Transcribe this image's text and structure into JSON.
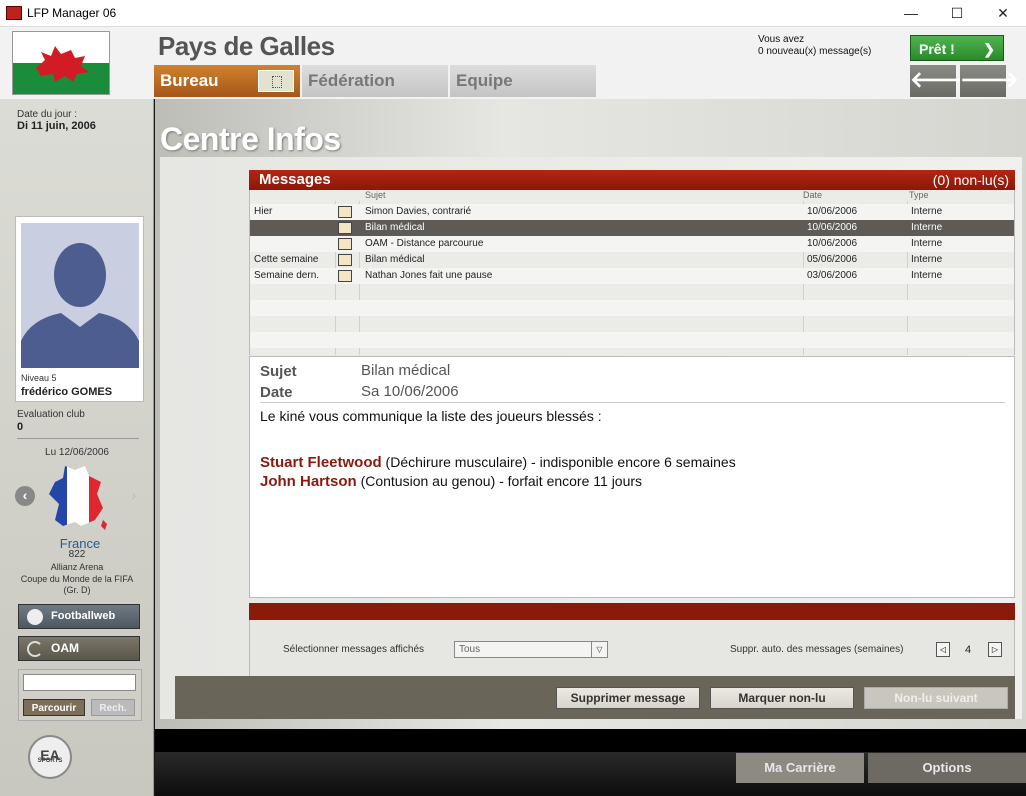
{
  "window": {
    "title": "LFP Manager 06",
    "min_glyph": "—",
    "max_glyph": "☐",
    "close_glyph": "✕"
  },
  "header": {
    "country": "Pays de Galles",
    "tabs": [
      {
        "label": "Bureau",
        "active": true
      },
      {
        "label": "Fédération",
        "active": false
      },
      {
        "label": "Equipe",
        "active": false
      }
    ],
    "notice_line1": "Vous avez",
    "notice_line2": "0 nouveau(x) message(s)",
    "ready_label": "Prêt !",
    "ready_arrow": "❯",
    "back_arrow": "🡐",
    "fwd_arrow": "🡒",
    "colors": {
      "active_tab": "#c2701f",
      "ready": "#3a9e3a"
    }
  },
  "sidebar": {
    "date_label": "Date du jour :",
    "date_value": "Di 11 juin, 2006",
    "level": "Niveau 5",
    "manager_name": "frédérico GOMES",
    "eval_label": "Evaluation club",
    "eval_value": "0",
    "next_match_date": "Lu 12/06/2006",
    "prev_arrow": "‹",
    "next_arrow": "›",
    "opponent": "France",
    "opponent_rank": "822",
    "venue": "Allianz Arena",
    "competition": "Coupe du Monde de la FIFA",
    "group": "(Gr. D)",
    "footballweb_label": "Footballweb",
    "oam_label": "OAM",
    "search_value": "",
    "browse_label": "Parcourir",
    "search_label": "Rech.",
    "ea_text": "EA",
    "ea_sports": "SPORTS"
  },
  "main": {
    "title": "Centre Infos",
    "messages_title": "Messages",
    "unread": "(0) non-lu(s)",
    "columns": {
      "subject": "Sujet",
      "date": "Date",
      "type": "Type"
    },
    "rows": [
      {
        "group": "Hier",
        "subject": "Simon Davies, contrarié",
        "date": "10/06/2006",
        "type": "Interne",
        "selected": false
      },
      {
        "group": "",
        "subject": "Bilan médical",
        "date": "10/06/2006",
        "type": "Interne",
        "selected": true
      },
      {
        "group": "",
        "subject": "OAM - Distance parcourue",
        "date": "10/06/2006",
        "type": "Interne",
        "selected": false
      },
      {
        "group": "Cette semaine",
        "subject": "Bilan médical",
        "date": "05/06/2006",
        "type": "Interne",
        "selected": false
      },
      {
        "group": "Semaine dern.",
        "subject": "Nathan Jones fait une pause",
        "date": "03/06/2006",
        "type": "Interne",
        "selected": false
      }
    ],
    "detail": {
      "subject_label": "Sujet",
      "subject_value": "Bilan médical",
      "date_label": "Date",
      "date_value": "Sa 10/06/2006",
      "intro": "Le kiné vous communique la liste des joueurs blessés :",
      "injuries": [
        {
          "player": "Stuart Fleetwood",
          "detail": " (Déchirure musculaire) - indisponible encore 6 semaines"
        },
        {
          "player": "John Hartson",
          "detail": " (Contusion au genou) - forfait encore 11 jours"
        }
      ]
    },
    "filter_label": "Sélectionner messages affichés",
    "filter_value": "Tous",
    "filter_dd": "▽",
    "autodel_label": "Suppr. auto. des messages (semaines)",
    "autodel_value": "4",
    "dec_glyph": "◁",
    "inc_glyph": "▷",
    "buttons": {
      "delete": "Supprimer message",
      "mark_unread": "Marquer non-lu",
      "next_unread": "Non-lu suivant"
    }
  },
  "bottom": {
    "career": "Ma Carrière",
    "options": "Options"
  }
}
